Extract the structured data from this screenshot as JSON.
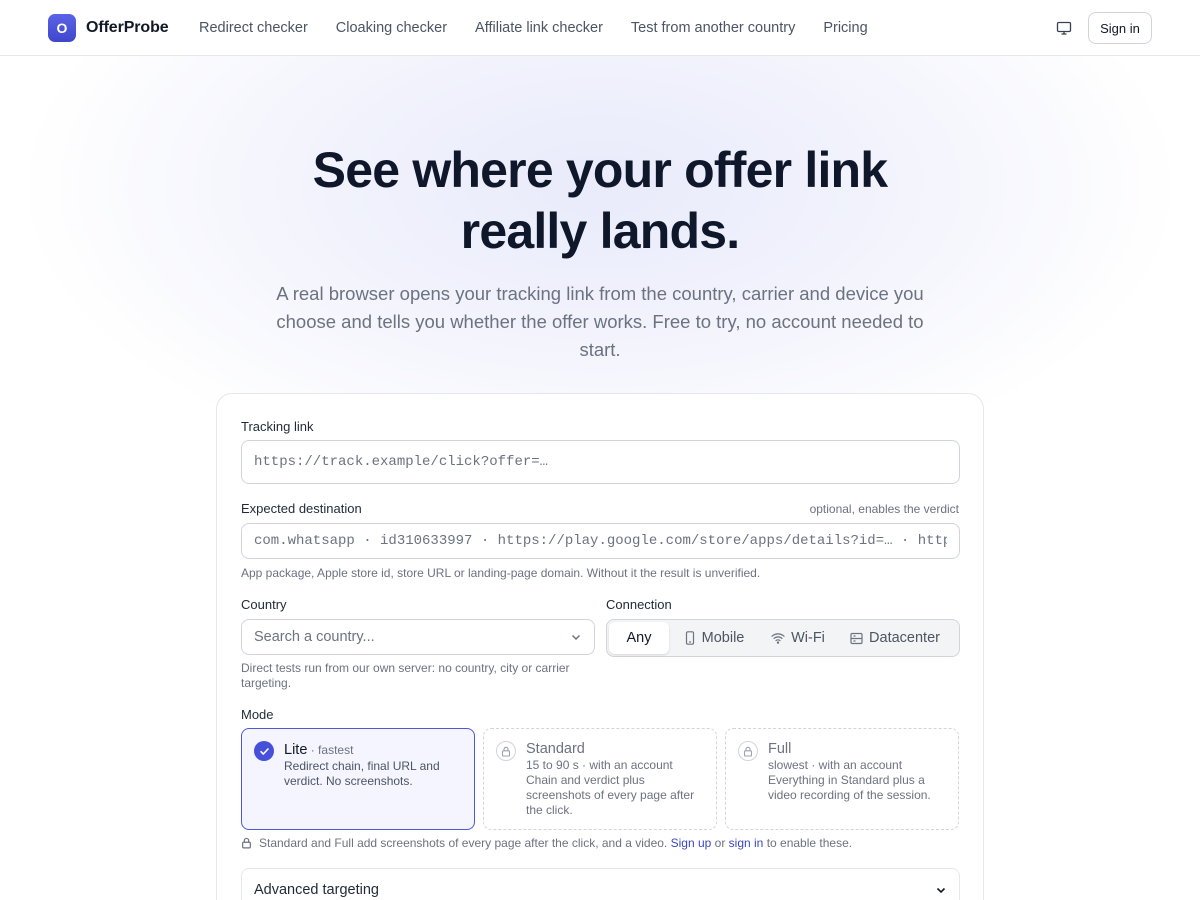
{
  "nav": {
    "logo_letter": "O",
    "brand": "OfferProbe",
    "links": [
      "Redirect checker",
      "Cloaking checker",
      "Affiliate link checker",
      "Test from another country",
      "Pricing"
    ],
    "theme_icon": "monitor-icon",
    "signin": "Sign in"
  },
  "hero": {
    "title": "See where your offer link really lands.",
    "subtitle": "A real browser opens your tracking link from the country, carrier and device you choose and tells you whether the offer works. Free to try, no account needed to start."
  },
  "form": {
    "tracking": {
      "label": "Tracking link",
      "placeholder": "https://track.example/click?offer=…",
      "value": ""
    },
    "expected": {
      "label": "Expected destination",
      "hint": "optional, enables the verdict",
      "placeholder": "com.whatsapp · id310633997 · https://play.google.com/store/apps/details?id=… · https://",
      "value": "",
      "help": "App package, Apple store id, store URL or landing-page domain. Without it the result is unverified."
    },
    "country": {
      "label": "Country",
      "placeholder": "Search a country...",
      "help": "Direct tests run from our own server: no country, city or carrier targeting."
    },
    "connection": {
      "label": "Connection",
      "options": [
        {
          "label": "Any",
          "icon": "",
          "active": true
        },
        {
          "label": "Mobile",
          "icon": "phone-icon",
          "active": false
        },
        {
          "label": "Wi-Fi",
          "icon": "wifi-icon",
          "active": false
        },
        {
          "label": "Datacenter",
          "icon": "server-icon",
          "active": false
        }
      ]
    },
    "mode": {
      "label": "Mode",
      "options": [
        {
          "title": "Lite",
          "sub": " · fastest",
          "meta": "",
          "desc": "Redirect chain, final URL and verdict. No screenshots.",
          "selected": true,
          "locked": false
        },
        {
          "title": "Standard",
          "sub": "",
          "meta": "15 to 90 s · with an account",
          "desc": "Chain and verdict plus screenshots of every page after the click.",
          "selected": false,
          "locked": true
        },
        {
          "title": "Full",
          "sub": "",
          "meta": "slowest · with an account",
          "desc": "Everything in Standard plus a video recording of the session.",
          "selected": false,
          "locked": true
        }
      ],
      "note_prefix": "Standard and Full add screenshots of every page after the click, and a video.",
      "signup": "Sign up",
      "or": "or",
      "signin": "sign in",
      "note_suffix": "to enable these."
    },
    "advanced": {
      "label": "Advanced targeting"
    }
  },
  "colors": {
    "accent": "#4650d8",
    "link": "#3b47c4",
    "selected_bg": "#f4f5fe"
  }
}
